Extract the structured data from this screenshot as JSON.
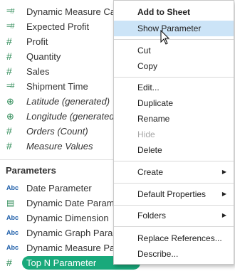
{
  "fields": [
    {
      "name": "Dynamic Measure Calc",
      "icon": "calc-field-icon",
      "italic": false
    },
    {
      "name": "Expected Profit",
      "icon": "calc-field-icon",
      "italic": false
    },
    {
      "name": "Profit",
      "icon": "measure-icon",
      "italic": false
    },
    {
      "name": "Quantity",
      "icon": "measure-icon",
      "italic": false
    },
    {
      "name": "Sales",
      "icon": "measure-icon",
      "italic": false
    },
    {
      "name": "Shipment Time",
      "icon": "calc-field-icon",
      "italic": false
    },
    {
      "name": "Latitude (generated)",
      "icon": "globe-icon",
      "italic": true
    },
    {
      "name": "Longitude (generated)",
      "icon": "globe-icon",
      "italic": true
    },
    {
      "name": "Orders (Count)",
      "icon": "measure-icon",
      "italic": true
    },
    {
      "name": "Measure Values",
      "icon": "measure-icon",
      "italic": true
    }
  ],
  "parameters_header": "Parameters",
  "parameters": [
    {
      "name": "Date Parameter",
      "icon": "abc-icon"
    },
    {
      "name": "Dynamic Date Parameter",
      "icon": "calendar-icon"
    },
    {
      "name": "Dynamic Dimension",
      "icon": "abc-icon"
    },
    {
      "name": "Dynamic Graph Parameter",
      "icon": "abc-icon"
    },
    {
      "name": "Dynamic Measure Parameter",
      "icon": "abc-icon"
    },
    {
      "name": "Top N Parameter",
      "icon": "measure-icon",
      "selected": true
    }
  ],
  "context_menu": {
    "add_to_sheet": "Add to Sheet",
    "show_parameter": "Show Parameter",
    "cut": "Cut",
    "copy": "Copy",
    "edit": "Edit...",
    "duplicate": "Duplicate",
    "rename": "Rename",
    "hide": "Hide",
    "delete": "Delete",
    "create": "Create",
    "default_properties": "Default Properties",
    "folders": "Folders",
    "replace_references": "Replace References...",
    "describe": "Describe..."
  },
  "colors": {
    "measure_green": "#2e8b57",
    "abc_blue": "#1f5faa",
    "selected_pill": "#19a97b",
    "menu_highlight": "#cce4f7"
  }
}
